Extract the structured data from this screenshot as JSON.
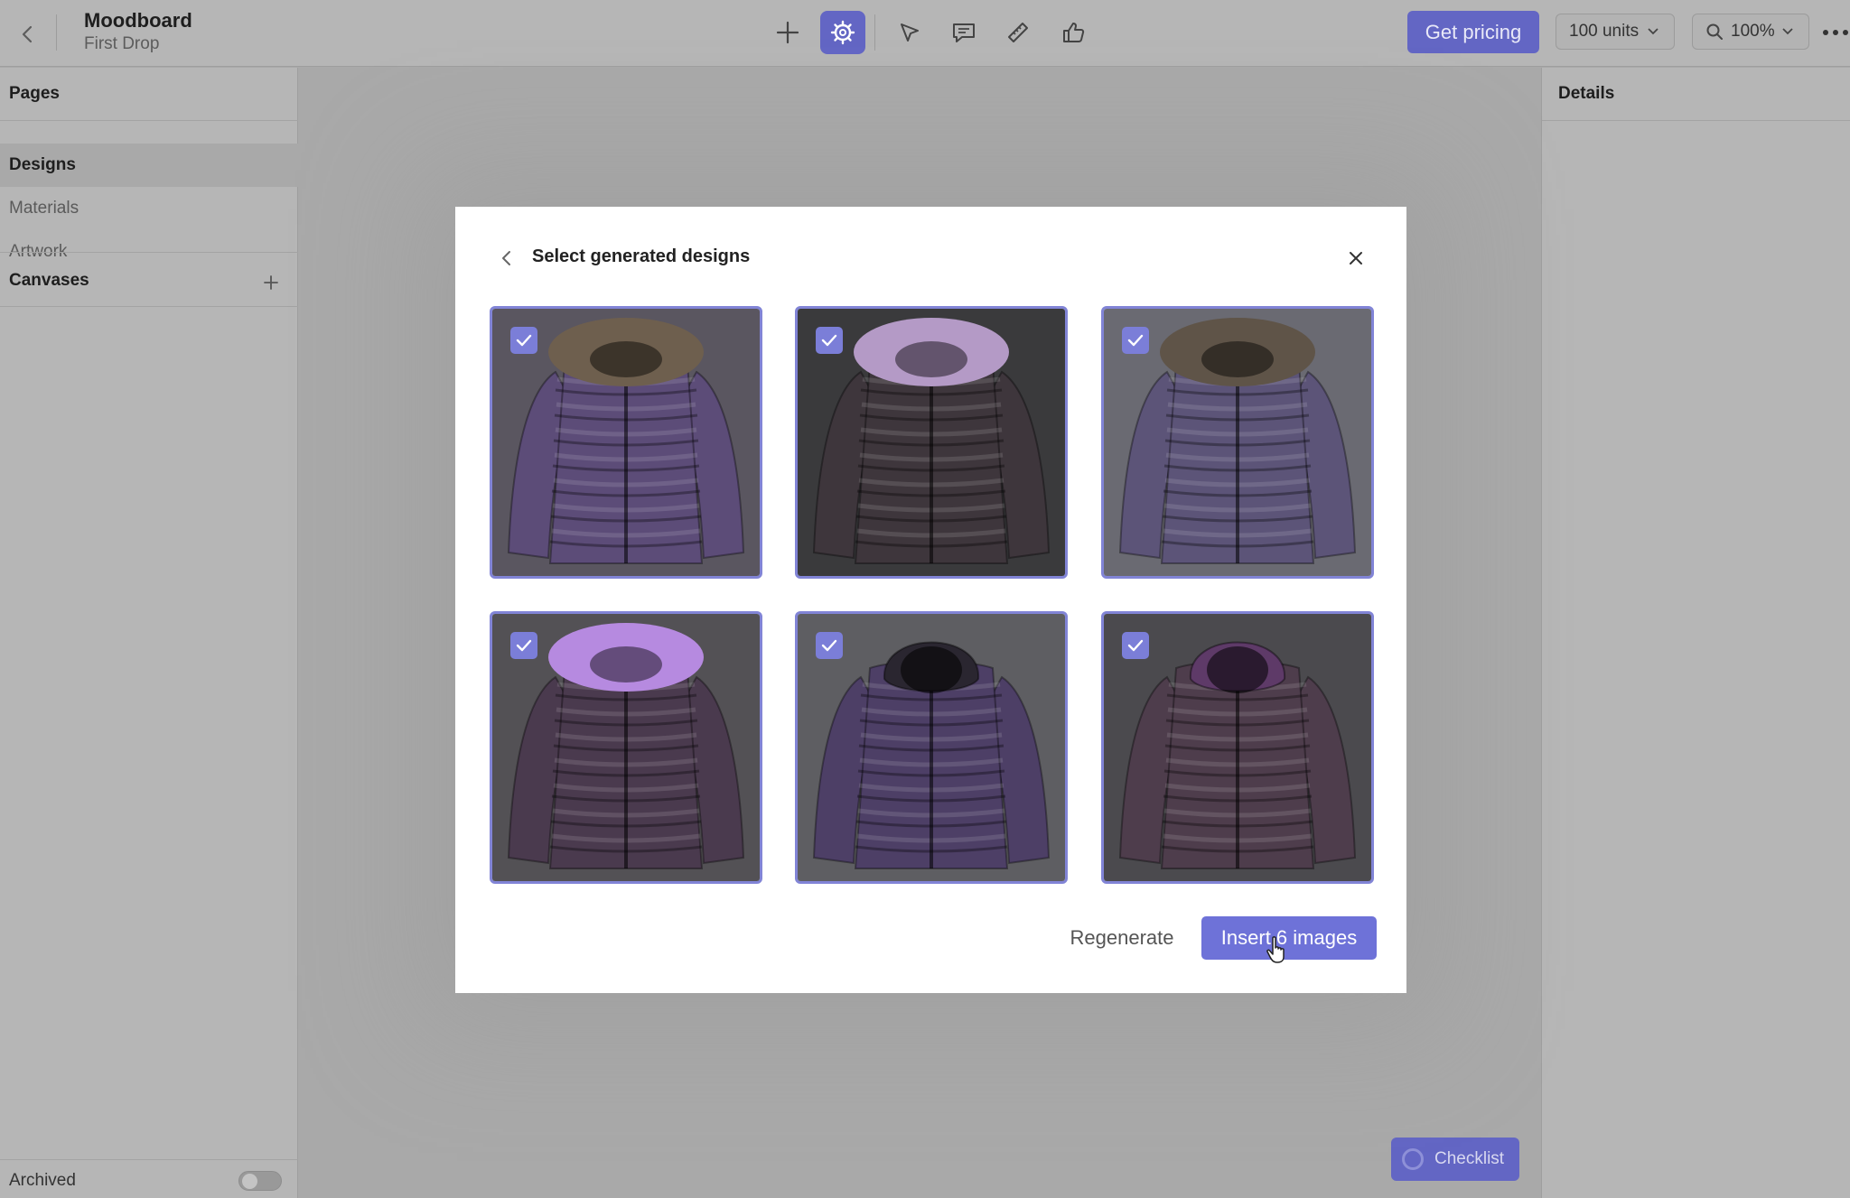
{
  "header": {
    "title": "Moodboard",
    "subtitle": "First Drop",
    "get_pricing_label": "Get pricing",
    "units_label": "100 units",
    "zoom_label": "100%"
  },
  "sidebar": {
    "pages_header": "Pages",
    "items": [
      {
        "label": "Designs",
        "active": true
      },
      {
        "label": "Materials",
        "active": false
      },
      {
        "label": "Artwork",
        "active": false
      }
    ],
    "canvases_header": "Canvases",
    "archived_label": "Archived",
    "archived_on": false
  },
  "details": {
    "title": "Details"
  },
  "checklist": {
    "label": "Checklist"
  },
  "modal": {
    "title": "Select generated designs",
    "regenerate_label": "Regenerate",
    "insert_label": "Insert 6 images",
    "cards": [
      {
        "selected": true,
        "bg": "#5a5660",
        "body": "#5c4c78",
        "fur": "#6e5f4e",
        "hood": false
      },
      {
        "selected": true,
        "bg": "#3a3a3c",
        "body": "#3e363c",
        "fur": "#b49ac6",
        "hood": false
      },
      {
        "selected": true,
        "bg": "#6a6a72",
        "body": "#5c5478",
        "fur": "#5f5448",
        "hood": false
      },
      {
        "selected": true,
        "bg": "#535155",
        "body": "#4a3a4e",
        "fur": "#b68ae0",
        "hood": false
      },
      {
        "selected": true,
        "bg": "#5e5e62",
        "body": "#4d3f66",
        "fur": "#2a2630",
        "hood": true
      },
      {
        "selected": true,
        "bg": "#4b4a4e",
        "body": "#4e3d4c",
        "fur": "#5e3a68",
        "hood": true
      }
    ]
  },
  "colors": {
    "accent": "#6366c4",
    "modal_accent": "#6e72d8",
    "card_border": "#8184d6"
  }
}
